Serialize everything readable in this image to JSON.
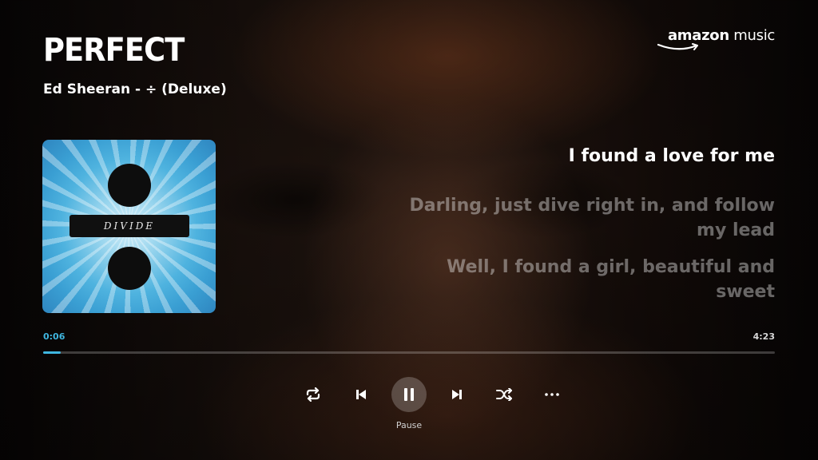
{
  "track": {
    "title": "PERFECT",
    "subtitle": "Ed Sheeran - ÷ (Deluxe)"
  },
  "brand": {
    "logo_text_bold": "amazon",
    "logo_text": " music"
  },
  "album_art": {
    "label": "DIVIDE"
  },
  "lyrics": {
    "current": "I found a love for me",
    "next": [
      "Darling, just dive right in, and follow my lead",
      "Well, I found a girl, beautiful and sweet"
    ]
  },
  "playback": {
    "elapsed": "0:06",
    "total": "4:23",
    "progress_fraction": 0.024,
    "pause_label": "Pause"
  },
  "controls": {
    "icons": [
      "repeat-icon",
      "previous-icon",
      "pause-icon",
      "next-icon",
      "shuffle-icon",
      "more-icon"
    ]
  },
  "colors": {
    "accent": "#3fb6e0",
    "lyric_current": "#ffffff",
    "lyric_next": "rgba(235,235,235,0.42)"
  }
}
